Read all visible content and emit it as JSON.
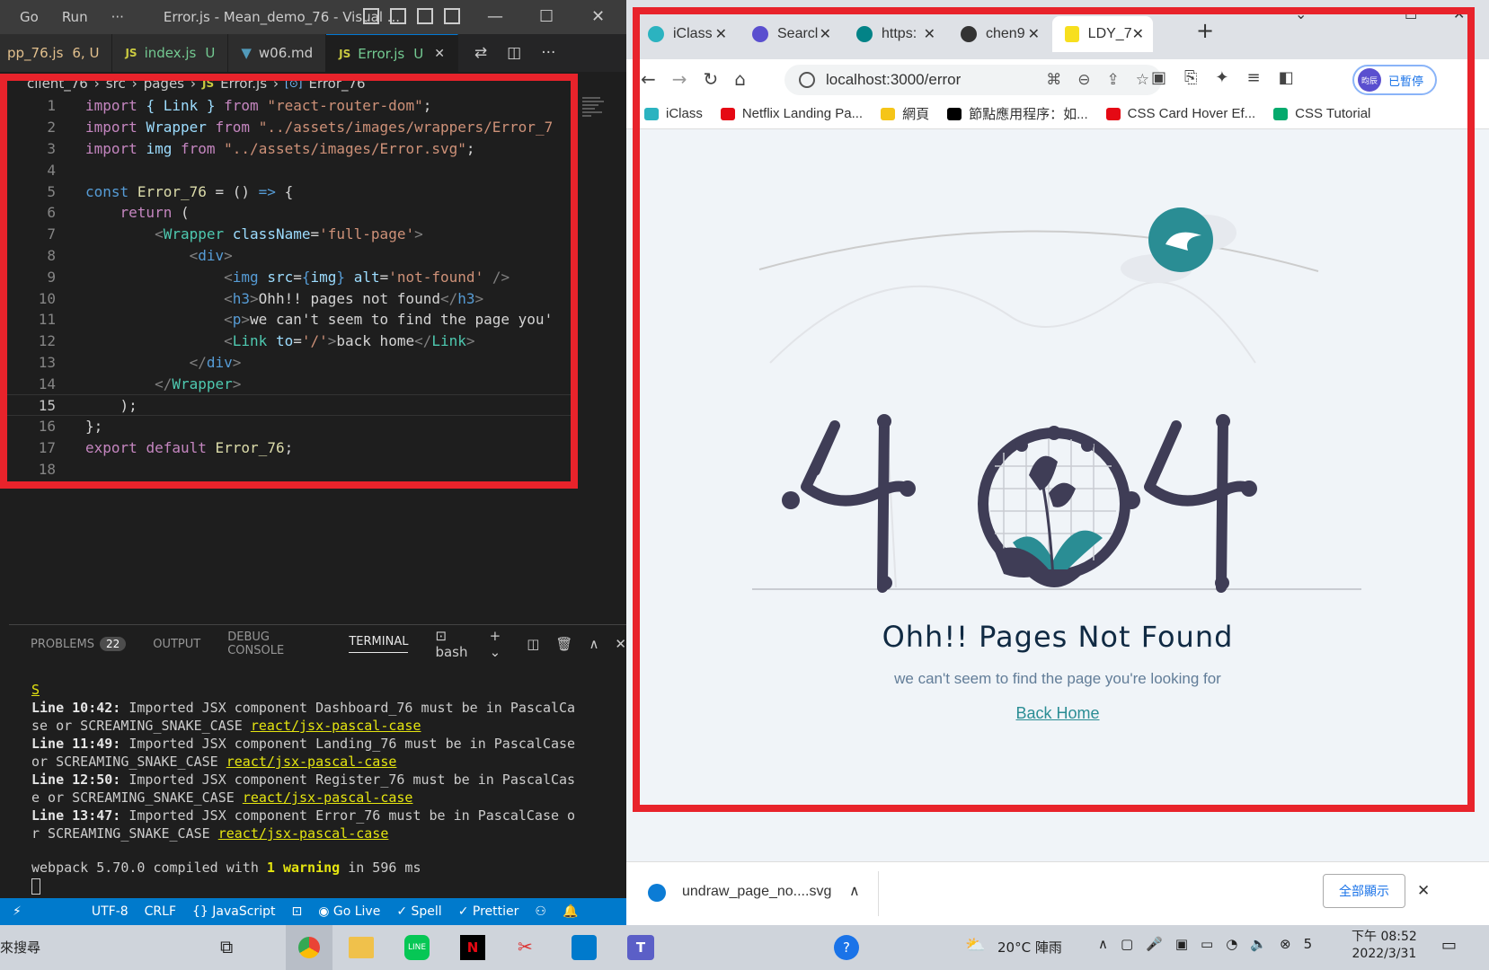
{
  "vscode": {
    "menu": [
      "Go",
      "Run",
      "···"
    ],
    "window_title": "Error.js - Mean_demo_76 - Visual ...",
    "tabs": [
      {
        "label": "pp_76.js",
        "status": "6, U"
      },
      {
        "label": "index.js",
        "status": "U"
      },
      {
        "label": "w06.md",
        "status": ""
      },
      {
        "label": "Error.js",
        "status": "U"
      }
    ],
    "breadcrumb": [
      "client_76",
      "src",
      "pages",
      "Error.js",
      "Error_76"
    ],
    "line_numbers": [
      "1",
      "2",
      "3",
      "4",
      "5",
      "6",
      "7",
      "8",
      "9",
      "10",
      "11",
      "12",
      "13",
      "14",
      "15",
      "16",
      "17",
      "18"
    ],
    "current_line": "15",
    "code_text": {
      "import": "import",
      "from": "from",
      "link_import": "{ Link }",
      "rrd": "\"react-router-dom\"",
      "wrapper": "Wrapper",
      "wrapper_path": "\"../assets/images/wrappers/Error_7",
      "img": "img",
      "img_path": "\"../assets/images/Error.svg\"",
      "const": "const",
      "comp": "Error_76",
      "return": "return",
      "classname": "className",
      "fullpage": "'full-page'",
      "div": "div",
      "src": "src",
      "alt": "alt",
      "notfound": "'not-found'",
      "h3": "h3",
      "h3_text": "Ohh!! pages not found",
      "p": "p",
      "p_text": "we can't seem to find the page you'",
      "link": "Link",
      "to": "to",
      "slash": "'/'",
      "link_text": "back home",
      "export": "export",
      "default": "default"
    }
  },
  "panel": {
    "tabs": [
      "PROBLEMS",
      "OUTPUT",
      "DEBUG CONSOLE",
      "TERMINAL"
    ],
    "problems_count": "22",
    "shell": "bash",
    "lines": [
      {
        "head": "Line 10:42:",
        "msg": "Imported JSX component Dashboard_76 must be in PascalCa",
        "msg2": "se or SCREAMING_SNAKE_CASE"
      },
      {
        "head": "Line 11:49:",
        "msg": "Imported JSX component Landing_76 must be in PascalCase",
        "msg2": " or SCREAMING_SNAKE_CASE"
      },
      {
        "head": "Line 12:50:",
        "msg": "Imported JSX component Register_76 must be in PascalCas",
        "msg2": "e or SCREAMING_SNAKE_CASE"
      },
      {
        "head": "Line 13:47:",
        "msg": "Imported JSX component Error_76 must be in PascalCase o",
        "msg2": "r SCREAMING_SNAKE_CASE"
      }
    ],
    "rule": "react/jsx-pascal-case",
    "webpack_pre": "webpack 5.70.0 compiled with",
    "webpack_warn": "1 warning",
    "webpack_post": "in 596 ms",
    "top_marker": "S"
  },
  "statusbar": [
    "UTF-8",
    "CRLF",
    "{} JavaScript",
    "Go Live",
    "Spell",
    "Prettier"
  ],
  "chrome": {
    "tabs": [
      {
        "label": "iClass",
        "color": "#2bb3c0"
      },
      {
        "label": "Searcl",
        "color": "#5a4fcf"
      },
      {
        "label": "https:",
        "color": "#038387"
      },
      {
        "label": "chen9",
        "color": "#333333"
      },
      {
        "label": "LDY_7",
        "color": "#f7df1e"
      }
    ],
    "url": "localhost:3000/error",
    "profile_label": "已暫停",
    "profile_initial": "昀辰",
    "bookmarks": [
      {
        "label": "iClass",
        "color": "#2bb3c0"
      },
      {
        "label": "Netflix Landing Pa...",
        "color": "#e50914"
      },
      {
        "label": "網頁",
        "color": "#f5c518"
      },
      {
        "label": "節點應用程序：如...",
        "color": "#000000"
      },
      {
        "label": "CSS Card Hover Ef...",
        "color": "#e50914"
      },
      {
        "label": "CSS Tutorial",
        "color": "#04aa6d"
      }
    ],
    "page": {
      "heading": "Ohh!! Pages Not Found",
      "text": "we can't seem to find the page you're looking for",
      "link": "Back Home",
      "accent": "#2a8d94",
      "ink": "#3f3d56"
    },
    "download_file": "undraw_page_no....svg",
    "show_all": "全部顯示"
  },
  "taskbar": {
    "search": "來搜尋",
    "weather": "20°C 陣雨",
    "time": "下午 08:52",
    "date": "2022/3/31"
  }
}
